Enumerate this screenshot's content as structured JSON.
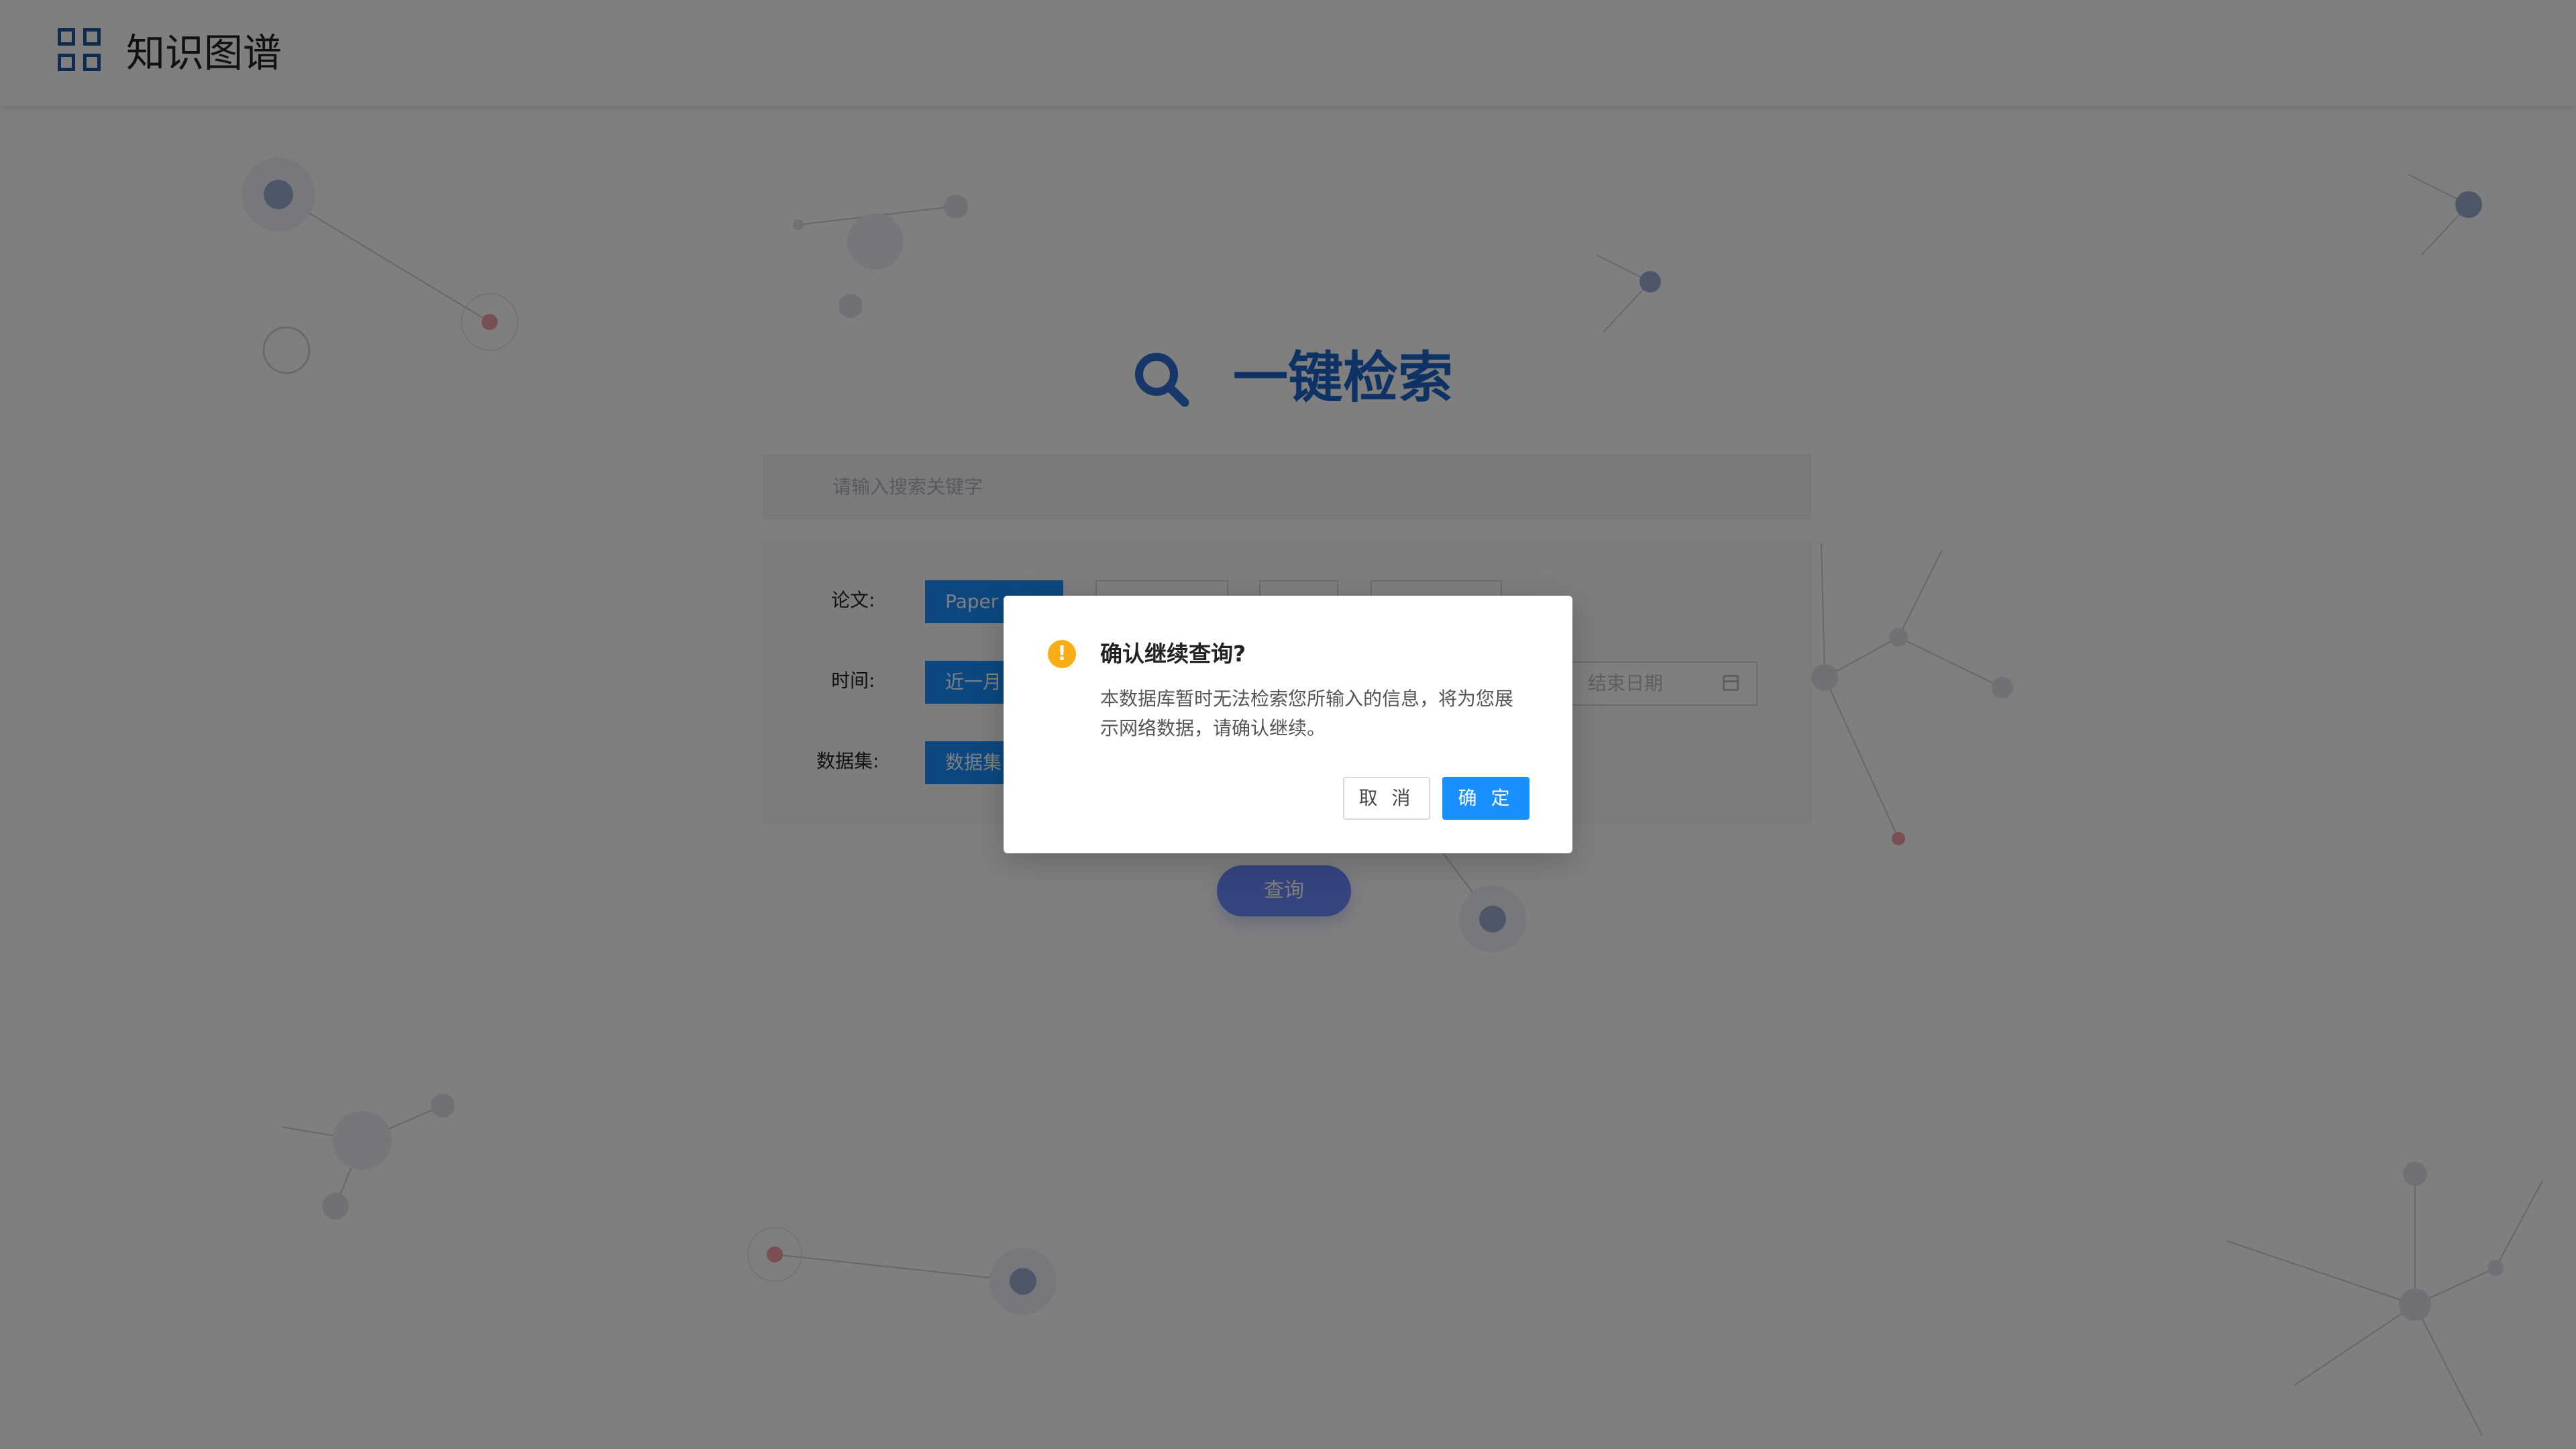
{
  "app": {
    "title": "知识图谱",
    "logo_icon": "grid-logo-icon"
  },
  "main": {
    "title": "一键检索",
    "title_icon": "search-icon",
    "search_placeholder": "请输入搜索关键字",
    "filters": {
      "paper_label": "论文:",
      "paper_option": "Paper",
      "time_label": "时间:",
      "time_option": "近一月",
      "end_date_placeholder": "结束日期",
      "dataset_label": "数据集:",
      "dataset_option": "数据集"
    },
    "query_button": "查询"
  },
  "dialog": {
    "title": "确认继续查询?",
    "body": "本数据库暂时无法检索您所输入的信息，将为您展示网络数据，请确认继续。",
    "cancel_label": "取 消",
    "ok_label": "确 定",
    "icon": "warning-icon"
  },
  "colors": {
    "brand": "#1e56a0",
    "title_blue": "#1e64c8",
    "primary_button": "#1890ff",
    "warning": "#faad14",
    "overlay": "rgba(0,0,0,0.5)"
  }
}
